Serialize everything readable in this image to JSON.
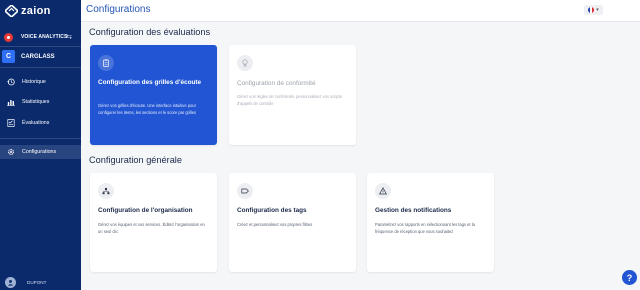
{
  "brand": {
    "name": "zaion"
  },
  "sidebar": {
    "module": "VOICE ANALYTICS",
    "client_initial": "C",
    "client_name": "CARGLASS",
    "items": [
      {
        "label": "Historique",
        "icon": "history-icon"
      },
      {
        "label": "Statistiques",
        "icon": "bar-chart-icon"
      },
      {
        "label": "Évaluations",
        "icon": "checklist-icon"
      },
      {
        "label": "Configurations",
        "icon": "gear-icon"
      }
    ],
    "active_item": "Configurations",
    "user_name": "DUPONT"
  },
  "header": {
    "title": "Configurations",
    "language": "fr"
  },
  "sections": [
    {
      "title": "Configuration des évaluations",
      "cards": [
        {
          "title": "Configuration des grilles d'écoute",
          "desc": "Gérez vos grilles d'écoute. Une interface intuitive pour configurer les items, les sections et le score par grilles",
          "icon": "clipboard-icon",
          "state": "primary"
        },
        {
          "title": "Configuration de conformité",
          "desc": "Gérez vos règles de conformité, personnalisez vos scripts d'appels de contrôle",
          "icon": "lightbulb-icon",
          "state": "disabled"
        }
      ]
    },
    {
      "title": "Configuration générale",
      "cards": [
        {
          "title": "Configuration de l'organisation",
          "desc": "Gérez vos équipes et vos services. Éditez l'organisation en un seul clic",
          "icon": "organization-icon",
          "state": "default"
        },
        {
          "title": "Configuration des tags",
          "desc": "Créez et personnalisez vos propres filtres",
          "icon": "tag-icon",
          "state": "default"
        },
        {
          "title": "Gestion des notifications",
          "desc": "Paramétrez vos rapports en sélectionnant les tags et la fréquence de réception que vous souhaitez",
          "icon": "warning-icon",
          "state": "default"
        }
      ]
    }
  ],
  "help_label": "?",
  "colors": {
    "sidebar": "#0a2a6c",
    "accent": "#2155d3",
    "title": "#2554b5"
  }
}
